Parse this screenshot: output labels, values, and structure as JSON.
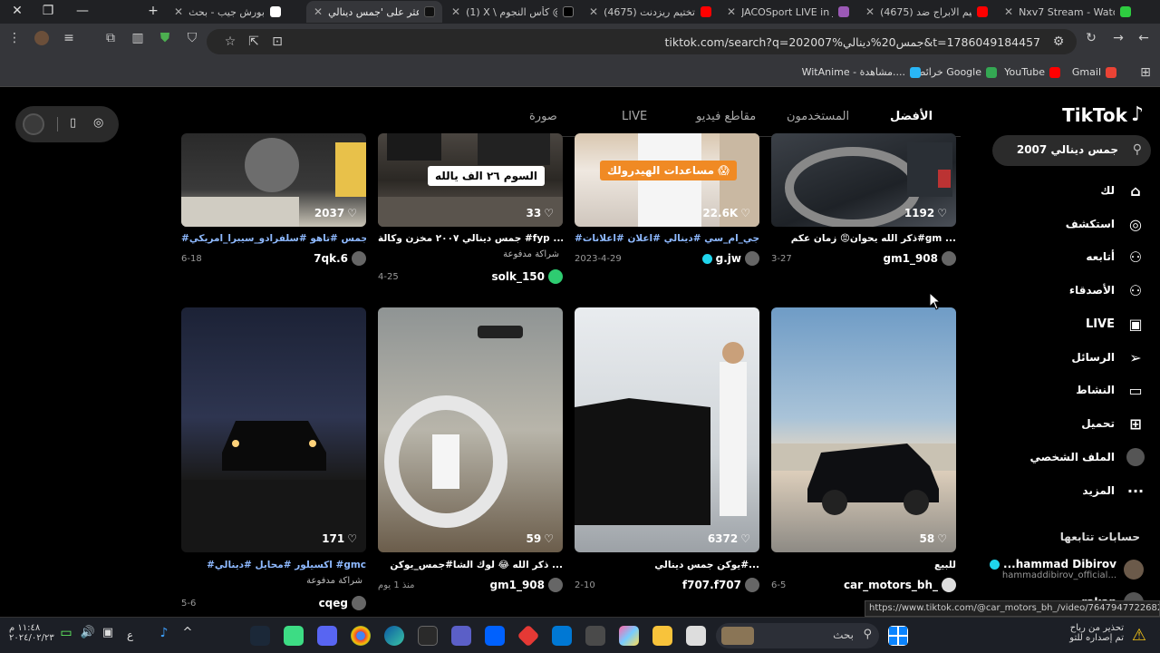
{
  "browser": {
    "tabs": [
      {
        "title": "Nxv7 Stream - Watc",
        "color": "#2ecc40"
      },
      {
        "title": "(4675) تيم الابراج ضد",
        "color": "#ff0000"
      },
      {
        "title": "JACOSport LIVE in JA",
        "color": "#9b59b6"
      },
      {
        "title": "(4675) تختيم ريزدنت",
        "color": "#ff0000"
      },
      {
        "title": "(1) X \\ كأس النجوم @",
        "color": "#ffffff"
      },
      {
        "title": "اعثر على 'جمس دينالي",
        "color": "#000000"
      },
      {
        "title": "بورش جيب - بحث Google",
        "color": "#4285f4"
      }
    ],
    "url": "tiktok.com/search?q=202007%جمس20%دينالي&t=1786049184457",
    "bookmarks": [
      "Gmail",
      "YouTube",
      "خرائط Google",
      "WitAnime - مشاهدة...."
    ],
    "status_url": "https://www.tiktok.com/@car_motors_bh_/video/7647947722682584341"
  },
  "tiktok": {
    "logo": "TikTok",
    "search_query": "جمس دينالي 2007",
    "nav": [
      {
        "label": "لك",
        "icon": "home-icon",
        "glyph": "⌂"
      },
      {
        "label": "استكشف",
        "icon": "compass-icon",
        "glyph": "◎"
      },
      {
        "label": "أتابعه",
        "icon": "following-icon",
        "glyph": "⚇"
      },
      {
        "label": "الأصدقاء",
        "icon": "friends-icon",
        "glyph": "⚇"
      },
      {
        "label": "LIVE",
        "icon": "live-icon",
        "glyph": "▣"
      },
      {
        "label": "الرسائل",
        "icon": "messages-icon",
        "glyph": "➢"
      },
      {
        "label": "النشاط",
        "icon": "activity-icon",
        "glyph": "▭"
      },
      {
        "label": "تحميل",
        "icon": "upload-icon",
        "glyph": "⊞"
      },
      {
        "label": "الملف الشخصي",
        "icon": "profile-icon",
        "glyph": ""
      },
      {
        "label": "المزيد",
        "icon": "more-icon",
        "glyph": "···"
      }
    ],
    "following_title": "حسابات تتابعها",
    "following": [
      {
        "name": "...hammad Dibirov",
        "handle": "hammaddibirov_official...",
        "verified": true
      },
      {
        "name": "rakan",
        "handle": "",
        "verified": false
      }
    ],
    "tabs": [
      "الأفضل",
      "المستخدمون",
      "مقاطع فيديو",
      "LIVE",
      "صورة"
    ],
    "videos_row1": [
      {
        "likes": "1192",
        "caption": "ذكر الله يحوان😡 زمان عكم#gm ...",
        "user": "gm1_908",
        "date": "3-27",
        "sponsored": "",
        "overlay": ""
      },
      {
        "likes": "22.6K",
        "caption": "#جي_ام_سي #دينالي #اعلان #اعلانات ...",
        "user": "g.jw",
        "date": "2023-4-29",
        "sponsored": "",
        "overlay": "مساعدات الهيدرولك 😱",
        "verified": true
      },
      {
        "likes": "33",
        "caption": "جمس دينالي ٢٠٠٧ مخزن وكالة #fyp ...",
        "user": "solk_150",
        "date": "4-25",
        "sponsored": "شراكة مدفوعة",
        "overlay": "السوم ٢٦ الف يالله"
      },
      {
        "likes": "2037",
        "caption": "#يوكن_جمس #تاهو #سلفرادو_سيبرا_امريكي ...",
        "user": "7qk.6",
        "date": "6-18",
        "sponsored": "",
        "overlay": ""
      }
    ],
    "videos_row2": [
      {
        "likes": "58",
        "caption": "للبيع",
        "user": "car_motors_bh_",
        "date": "6-5",
        "sponsored": ""
      },
      {
        "likes": "6372",
        "caption": "يوكن جمس دينالي#...",
        "user": "f707.f707",
        "date": "2-10",
        "sponsored": ""
      },
      {
        "likes": "59",
        "caption": "ذكر الله 😂 لوك الشا#جمس_يوكن ...",
        "user": "gm1_908",
        "date": "منذ 1 يوم",
        "sponsored": ""
      },
      {
        "likes": "171",
        "caption": "#اكسيلور #محايل #دينالي #gmc",
        "user": "cqeg",
        "date": "5-6",
        "sponsored": "شراكة مدفوعة"
      }
    ]
  },
  "taskbar": {
    "search_label": "بحث",
    "notification_line1": "تحذير من رباح",
    "notification_line2": "تم إصداره للتو",
    "time": "١١:٤٨ م",
    "date": "٢٠٢٤/٠٢/٢٣",
    "lang": "ع"
  }
}
